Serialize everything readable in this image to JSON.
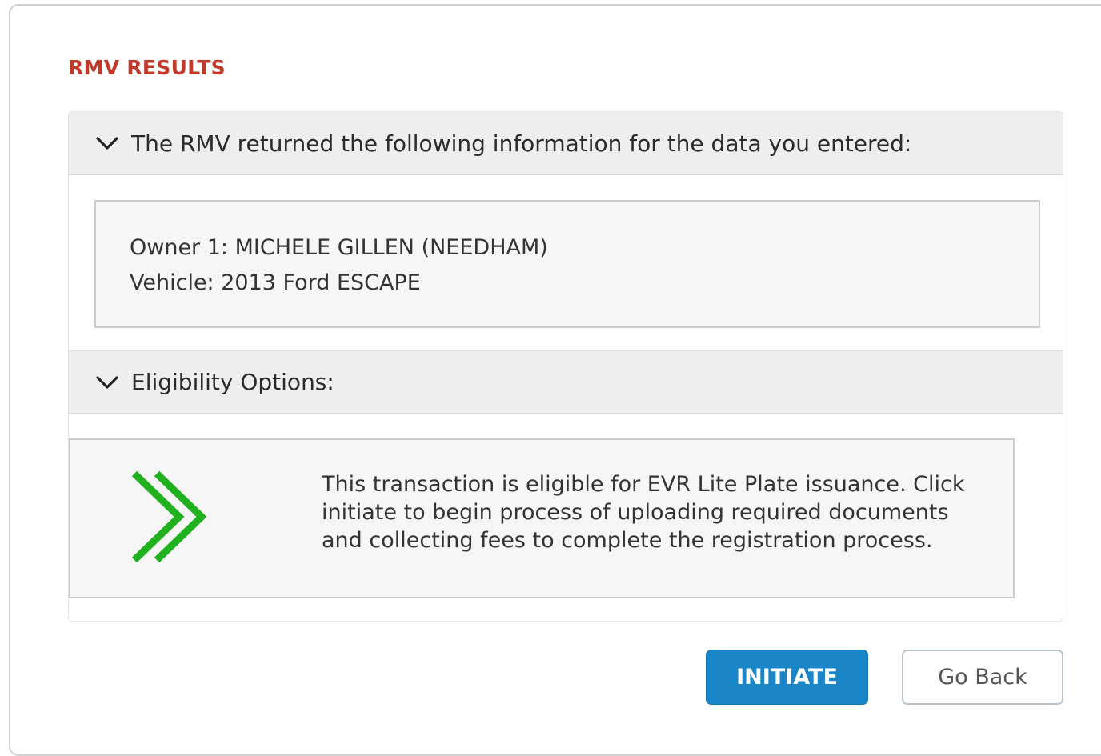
{
  "colors": {
    "title_red": "#c0392b",
    "accent_blue": "#1a85c7",
    "success_green": "#22b11e"
  },
  "results": {
    "title": "RMV RESULTS",
    "returned_section": {
      "icon": "chevron-down-icon",
      "header": "The RMV returned the following information for the data you entered:",
      "owner_line": "Owner 1: MICHELE GILLEN (NEEDHAM)",
      "vehicle_line": "Vehicle: 2013 Ford ESCAPE"
    },
    "eligibility_section": {
      "icon": "chevron-down-icon",
      "header": "Eligibility Options:",
      "status_icon": "double-chevron-right-icon",
      "message": "This transaction is eligible for EVR Lite Plate issuance. Click initiate to begin process of uploading required documents and collecting fees to complete the registration process."
    }
  },
  "actions": {
    "initiate_label": "INITIATE",
    "go_back_label": "Go Back"
  }
}
